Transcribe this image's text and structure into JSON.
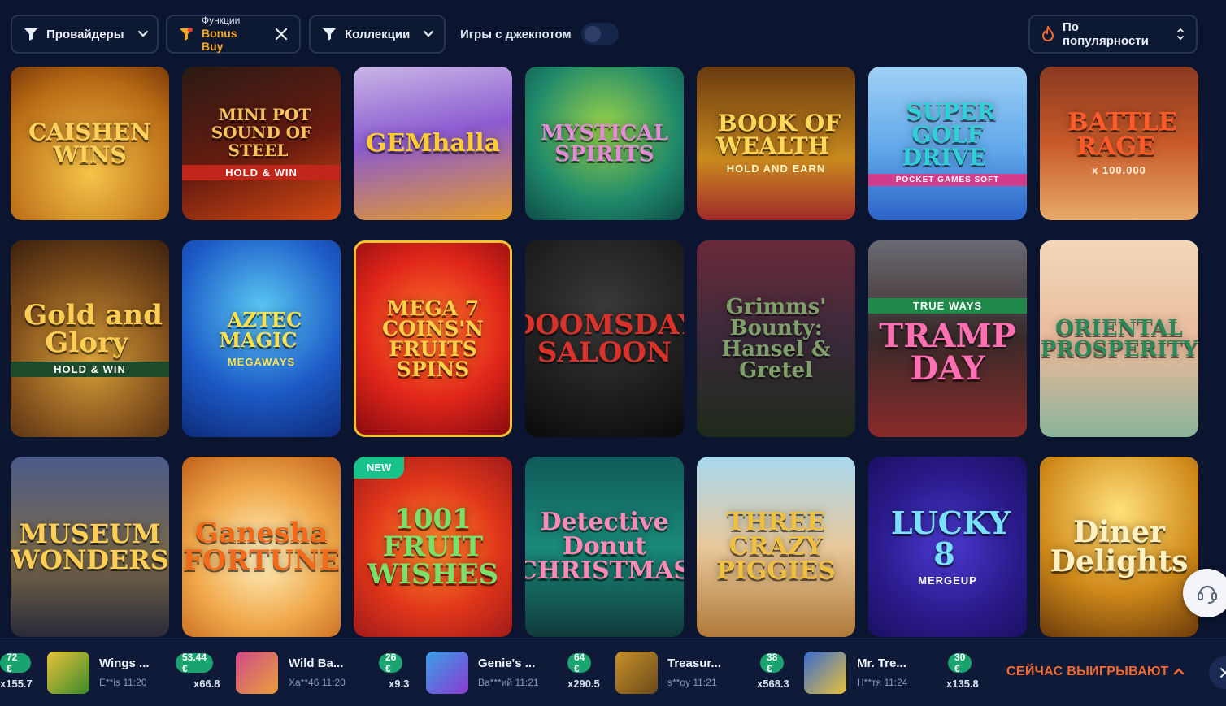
{
  "filters": {
    "providers_label": "Провайдеры",
    "functions_label": "Функции",
    "functions_value": "Bonus Buy",
    "collections_label": "Коллекции",
    "jackpot_label": "Игры с джекпотом",
    "jackpot_on": false,
    "sort_label": "По популярности"
  },
  "games": [
    {
      "title": "CAISHEN WINS",
      "sub": "",
      "new": false
    },
    {
      "title": "MINI POT SOUND OF STEEL",
      "sub": "HOLD & WIN",
      "new": false
    },
    {
      "title": "GEMhalla",
      "sub": "",
      "new": false
    },
    {
      "title": "MYSTICAL SPIRITS",
      "sub": "",
      "new": false
    },
    {
      "title": "BOOK OF WEALTH",
      "sub": "HOLD AND EARN",
      "new": false
    },
    {
      "title": "SUPER GOLF DRIVE",
      "sub": "POCKET GAMES SOFT",
      "new": false
    },
    {
      "title": "BATTLE RAGE",
      "sub": "x 100.000",
      "new": false
    },
    {
      "title": "Gold and Glory",
      "sub": "HOLD & WIN",
      "new": false
    },
    {
      "title": "AZTEC MAGIC",
      "sub": "MEGAWAYS",
      "new": false
    },
    {
      "title": "MEGA 7 COINS'N FRUITS SPINS",
      "sub": "",
      "new": false
    },
    {
      "title": "DOOMSDAY SALOON",
      "sub": "",
      "new": false
    },
    {
      "title": "Grimms' Bounty: Hansel & Gretel",
      "sub": "",
      "new": false
    },
    {
      "title": "TRAMP DAY",
      "sub": "TRUE WAYS",
      "new": false
    },
    {
      "title": "ORIENTAL PROSPERITY",
      "sub": "",
      "new": false
    },
    {
      "title": "MUSEUM WONDERS",
      "sub": "",
      "new": false
    },
    {
      "title": "Ganesha FORTUNE",
      "sub": "",
      "new": false
    },
    {
      "title": "1001 FRUIT WISHES",
      "sub": "",
      "new": true
    },
    {
      "title": "Detective Donut CHRISTMAS",
      "sub": "",
      "new": false
    },
    {
      "title": "THREE CRAZY PIGGIES",
      "sub": "",
      "new": false
    },
    {
      "title": "LUCKY 8",
      "sub": "MERGEUP",
      "new": false
    },
    {
      "title": "Diner Delights",
      "sub": "",
      "new": false
    }
  ],
  "new_badge": "NEW",
  "ticker": {
    "items": [
      {
        "amount": "72 €",
        "mult": "x155.7",
        "game": "Wings ...",
        "user": "E**is",
        "time": "11:20"
      },
      {
        "amount": "53.44 €",
        "mult": "x66.8",
        "game": "Wild Ba...",
        "user": "Xa**46",
        "time": "11:20"
      },
      {
        "amount": "26 €",
        "mult": "x9.3",
        "game": "Genie's ...",
        "user": "Ba***ий",
        "time": "11:21"
      },
      {
        "amount": "64 €",
        "mult": "x290.5",
        "game": "Treasur...",
        "user": "s**oy",
        "time": "11:21"
      },
      {
        "amount": "38 €",
        "mult": "x568.3",
        "game": "Mr. Tre...",
        "user": "Н**тя",
        "time": "11:24"
      },
      {
        "amount": "30 €",
        "mult": "x135.8",
        "game": "",
        "user": "",
        "time": ""
      }
    ],
    "now_playing_label": "СЕЙЧАС ВЫИГРЫВАЮТ"
  },
  "colors": {
    "bg": "#0b1530",
    "accent_orange": "#f26a2e",
    "bonus_buy": "#f4a623",
    "win_green": "#1aa36f"
  }
}
